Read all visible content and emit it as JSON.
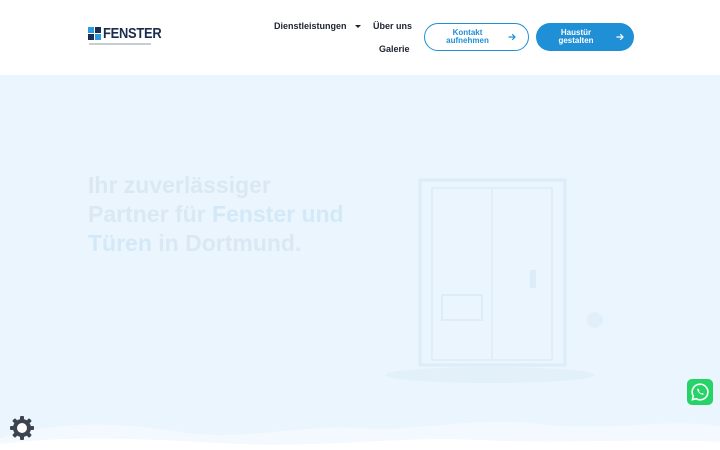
{
  "header": {
    "logo_text": "FENSTER",
    "nav": {
      "services": "Dienstleistungen",
      "about": "Über uns",
      "gallery": "Galerie"
    },
    "buttons": {
      "contact": "Kontakt aufnehmen",
      "configure": "Haustür gestalten"
    }
  },
  "hero": {
    "title_part1": "Ihr zuverlässiger Partner für ",
    "title_accent": "Fenster und Türen",
    "title_part2": " in Dortmund."
  },
  "colors": {
    "accent": "#1f8fd6",
    "hero_bg": "#eaf5fd",
    "whatsapp": "#25d366",
    "logo_dark": "#1b2d4c"
  },
  "icons": {
    "arrow": "arrow-right-icon",
    "caret": "chevron-down-icon",
    "whatsapp": "whatsapp-icon",
    "cookie": "gear-icon"
  }
}
